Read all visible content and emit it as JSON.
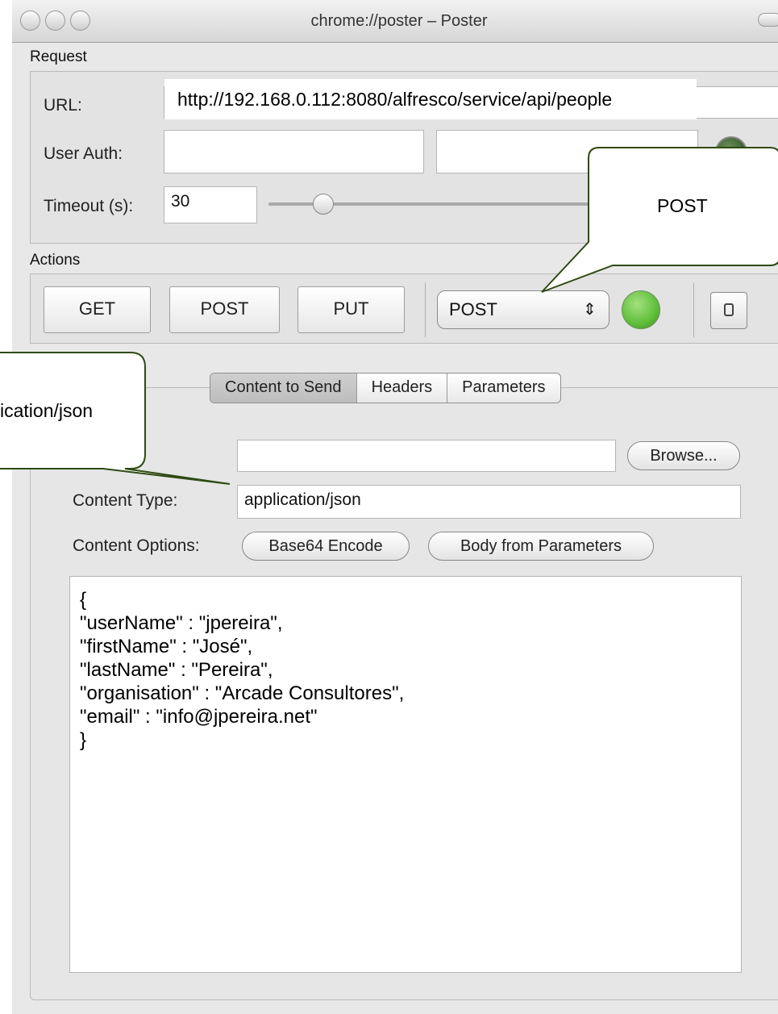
{
  "window": {
    "title": "chrome://poster – Poster"
  },
  "request": {
    "section_label": "Request",
    "url_label": "URL:",
    "url_value": "http://192.168.0.112:8080/alfresco/service/api/people",
    "user_auth_label": "User Auth:",
    "user_value": "",
    "password_value": "",
    "timeout_label": "Timeout (s):",
    "timeout_value": "30"
  },
  "actions": {
    "section_label": "Actions",
    "get_label": "GET",
    "post_label": "POST",
    "put_label": "PUT",
    "method_select_value": "POST",
    "method_select_arrows": "⇕"
  },
  "tabs": [
    {
      "label": "Content to Send",
      "active": true
    },
    {
      "label": "Headers",
      "active": false
    },
    {
      "label": "Parameters",
      "active": false
    }
  ],
  "content": {
    "file_value": "",
    "browse_label": "Browse...",
    "content_type_label": "Content Type:",
    "content_type_value": "application/json",
    "content_options_label": "Content Options:",
    "base64_label": "Base64 Encode",
    "body_from_params_label": "Body from Parameters",
    "body": "{\n\"userName\" : \"jpereira\",\n\"firstName\" : \"José\",\n\"lastName\" : \"Pereira\",\n\"organisation\" : \"Arcade Consultores\",\n\"email\" : \"info@jpereira.net\"\n}"
  },
  "callouts": {
    "method_callout": "POST",
    "content_type_callout": "ication/json"
  },
  "colors": {
    "status_green": "#5fbf3a",
    "callout_stroke": "#2e4a12"
  }
}
